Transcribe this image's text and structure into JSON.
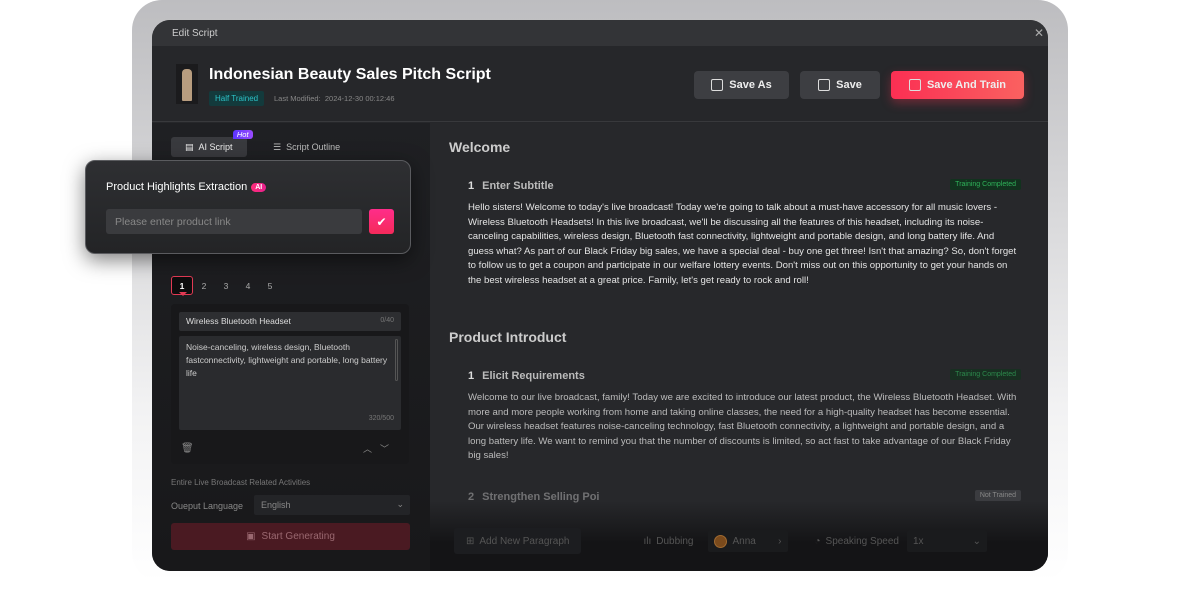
{
  "window": {
    "title": "Edit Script",
    "close_icon": "close-icon"
  },
  "header": {
    "title": "Indonesian Beauty Sales Pitch Script",
    "status": "Half Trained",
    "last_modified_label": "Last Modified:",
    "last_modified": "2024-12-30 00:12:46",
    "buttons": {
      "save_as": "Save As",
      "save": "Save",
      "save_and_train": "Save And Train"
    }
  },
  "left": {
    "tabs": [
      {
        "label": "AI Script",
        "badge": "Hot"
      },
      {
        "label": "Script Outline"
      }
    ],
    "pages": [
      "1",
      "2",
      "3",
      "4",
      "5"
    ],
    "product": {
      "name": "Wireless Bluetooth Headset",
      "name_count": "0/40",
      "description": "Noise-canceling, wireless design, Bluetooth fastconnectivity, lightweight and portable, long battery life",
      "desc_count": "320/500"
    },
    "faded_label": "Entire Live Broadcast Related Activities",
    "language_label": "Oueput Language",
    "language": "English",
    "generate": "Start Generating"
  },
  "popup": {
    "title": "Product Highlights Extraction",
    "badge": "AI",
    "placeholder": "Please enter product link"
  },
  "right": {
    "sections": [
      {
        "title": "Welcome",
        "items": [
          {
            "num": "1",
            "title": "Enter Subtitle",
            "status": "Training Completed",
            "text": "Hello sisters! Welcome to today's live broadcast! Today we're going to talk about a must-have accessory for all music lovers - Wireless Bluetooth Headsets! In this live broadcast, we'll be discussing all the features of this headset, including its noise-canceling capabilities, wireless design, Bluetooth fast connectivity, lightweight and portable design, and long battery life. And guess what? As part of our Black Friday big sales, we have a special deal - buy one get three! Isn't that amazing? So, don't forget to follow us to get a coupon and participate in our welfare lottery events. Don't miss out on this opportunity to get your hands on the best wireless headset at a great price. Family, let's get ready to rock and roll!"
          }
        ]
      },
      {
        "title": "Product Introduct",
        "items": [
          {
            "num": "1",
            "title": "Elicit Requirements",
            "status": "Training Completed",
            "text": "Welcome to our live broadcast, family! Today we are excited to introduce our latest product, the Wireless Bluetooth Headset. With more and more people working from home and taking online classes, the need for a high-quality headset has become essential. Our wireless headset features noise-canceling technology, fast Bluetooth connectivity, a lightweight and portable design, and a long battery life. We want to remind you that the number of discounts is limited, so act fast to take advantage of our Black Friday big sales!"
          },
          {
            "num": "2",
            "title": "Strengthen Selling Poi",
            "status": "Not Trained"
          }
        ]
      }
    ],
    "bottom": {
      "add_paragraph": "Add New Paragraph",
      "dubbing": "Dubbing",
      "voice": "Anna",
      "speed_label": "Speaking Speed",
      "speed": "1x"
    }
  },
  "colors": {
    "accent": "#fb2f53",
    "trained": "#2fb35a",
    "half_trained": "#2cc3c8"
  }
}
